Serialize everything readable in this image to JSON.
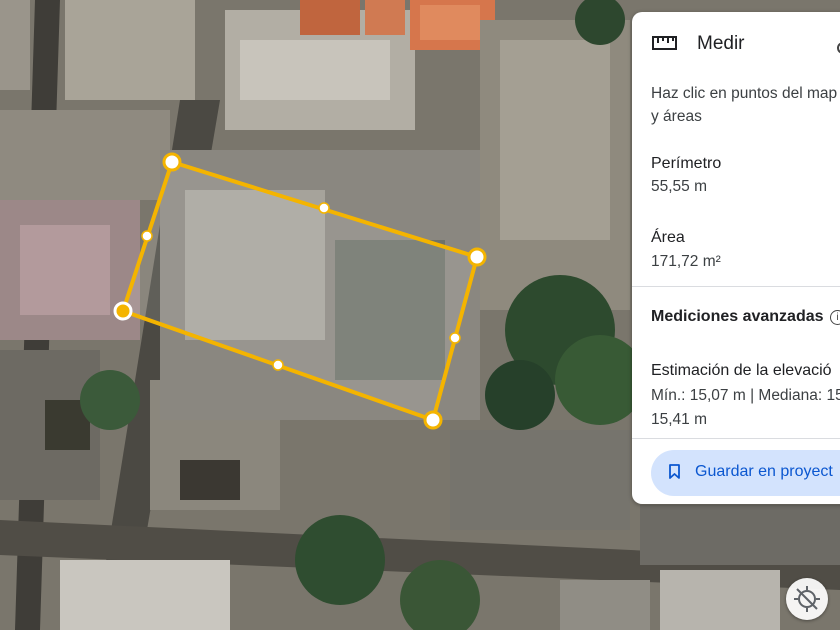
{
  "map": {
    "type": "satellite"
  },
  "measurement": {
    "shape": "closed-polygon",
    "line_color": "#F4B400",
    "vertex_count": 4
  },
  "panel": {
    "title": "Medir",
    "instructions_line1": "Haz clic en puntos del map",
    "instructions_line2": "y áreas",
    "perimeter_label": "Perímetro",
    "perimeter_value": "55,55 m",
    "area_label": "Área",
    "area_value": "171,72 m²",
    "advanced_label": "Mediciones avanzadas",
    "elevation_title": "Estimación de la elevació",
    "elevation_line1": "Mín.: 15,07 m | Mediana: 15",
    "elevation_line2": "15,41 m",
    "save_label": "Guardar en proyect"
  },
  "colors": {
    "accent": "#0B57D0",
    "button_bg": "#D3E3FD",
    "measure_line": "#F4B400"
  },
  "icons": [
    "ruler-icon",
    "info-icon",
    "bookmark-icon",
    "location-off-icon",
    "more-options-icon"
  ]
}
